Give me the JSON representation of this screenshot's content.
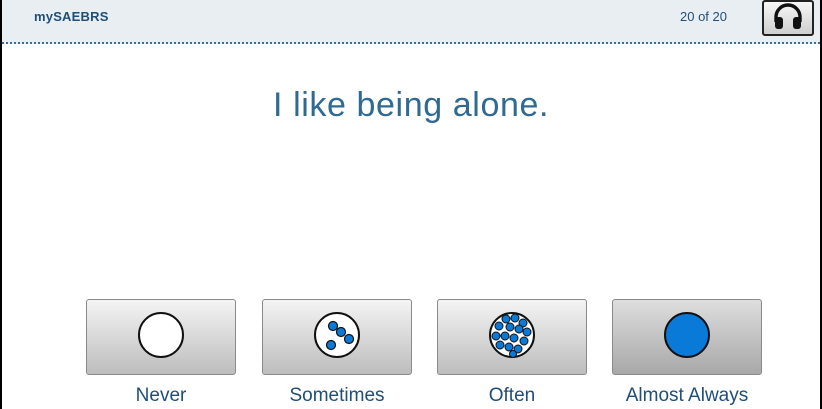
{
  "header": {
    "app_name": "mySAEBRS",
    "progress": "20 of 20",
    "audio_icon": "headphones-icon"
  },
  "question": {
    "text": "I like being alone."
  },
  "choices": [
    {
      "label": "Never",
      "icon": "empty-circle-icon",
      "selected": false
    },
    {
      "label": "Sometimes",
      "icon": "few-dots-circle-icon",
      "selected": false
    },
    {
      "label": "Often",
      "icon": "many-dots-circle-icon",
      "selected": false
    },
    {
      "label": "Almost Always",
      "icon": "filled-circle-icon",
      "selected": true
    }
  ],
  "colors": {
    "text_blue": "#1f4e78",
    "question_blue": "#2e6a93",
    "dot_blue": "#0a7ad8"
  }
}
